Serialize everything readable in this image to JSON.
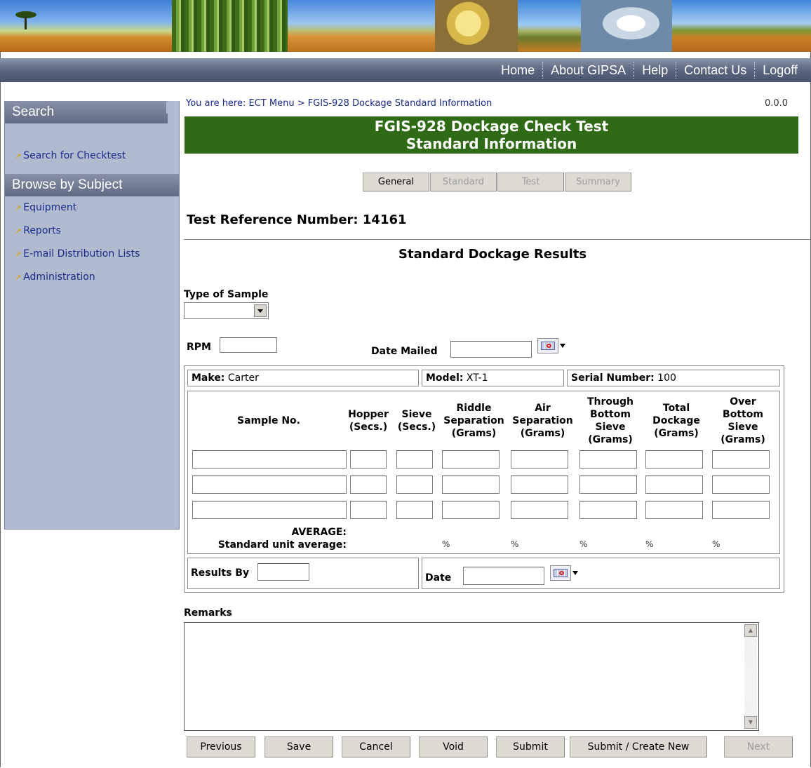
{
  "nav": {
    "links": [
      "Home",
      "About GIPSA",
      "Help",
      "Contact Us",
      "Logoff"
    ]
  },
  "sidebar": {
    "search_title": "Search",
    "search_link": "Search for Checktest",
    "browse_title": "Browse by Subject",
    "items": [
      "Equipment",
      "Reports",
      "E-mail Distribution Lists",
      "Administration"
    ]
  },
  "breadcrumb": "You are here: ECT Menu > FGIS-928 Dockage Standard Information",
  "version": "0.0.0",
  "title_line1": "FGIS-928 Dockage Check Test",
  "title_line2": "Standard Information",
  "tabs": [
    {
      "label": "General",
      "enabled": true
    },
    {
      "label": "Standard",
      "enabled": false
    },
    {
      "label": "Test",
      "enabled": false
    },
    {
      "label": "Summary",
      "enabled": false
    }
  ],
  "test_reference": "Test Reference Number: 14161",
  "section_title": "Standard Dockage Results",
  "form": {
    "type_of_sample_label": "Type of Sample",
    "type_of_sample_value": "",
    "rpm_label": "RPM",
    "rpm_value": "",
    "date_mailed_label": "Date Mailed",
    "date_mailed_value": ""
  },
  "equipment": {
    "make_label": "Make:",
    "make_value": "Carter",
    "model_label": "Model:",
    "model_value": "XT-1",
    "serial_label": "Serial Number:",
    "serial_value": "100"
  },
  "table": {
    "headers": [
      "Sample No.",
      "Hopper (Secs.)",
      "Sieve (Secs.)",
      "Riddle Separation (Grams)",
      "Air Separation (Grams)",
      "Through Bottom Sieve (Grams)",
      "Total Dockage (Grams)",
      "Over Bottom Sieve (Grams)"
    ],
    "rows": [
      [
        "",
        "",
        "",
        "",
        "",
        "",
        "",
        ""
      ],
      [
        "",
        "",
        "",
        "",
        "",
        "",
        "",
        ""
      ],
      [
        "",
        "",
        "",
        "",
        "",
        "",
        "",
        ""
      ]
    ],
    "average_label": "AVERAGE:",
    "unit_average_label": "Standard unit average:",
    "percent_symbol": "%"
  },
  "results_by_label": "Results By",
  "results_by_value": "",
  "date_label": "Date",
  "date_value": "",
  "remarks_label": "Remarks",
  "remarks_value": "",
  "buttons": [
    {
      "label": "Previous",
      "enabled": true
    },
    {
      "label": "Save",
      "enabled": true
    },
    {
      "label": "Cancel",
      "enabled": true
    },
    {
      "label": "Void",
      "enabled": true
    },
    {
      "label": "Submit",
      "enabled": true
    },
    {
      "label": "Submit / Create New",
      "enabled": true
    },
    {
      "label": "Next",
      "enabled": false
    }
  ]
}
